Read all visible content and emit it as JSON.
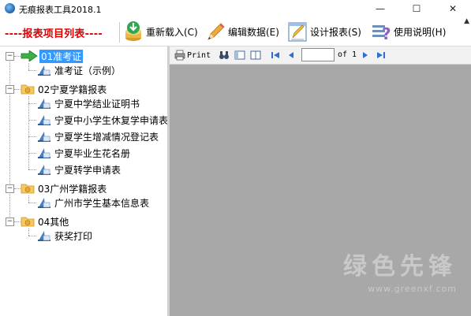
{
  "window": {
    "title": "无痕报表工具2018.1",
    "minimize": "—",
    "maximize": "☐",
    "close": "✕"
  },
  "toolbar": {
    "list_heading": "----报表项目列表----",
    "buttons": [
      {
        "label": "重新载入(C)",
        "icon": "reload-icon"
      },
      {
        "label": "编辑数据(E)",
        "icon": "pencil-icon"
      },
      {
        "label": "设计报表(S)",
        "icon": "design-icon"
      },
      {
        "label": "使用说明(H)",
        "icon": "help-icon"
      }
    ]
  },
  "tree": {
    "groups": [
      {
        "label": "01准考证",
        "selected": true,
        "items": [
          "准考证（示例）"
        ]
      },
      {
        "label": "02宁夏学籍报表",
        "items": [
          "宁夏中学结业证明书",
          "宁夏中小学生休复学申请表",
          "宁夏学生增减情况登记表",
          "宁夏毕业生花名册",
          "宁夏转学申请表"
        ]
      },
      {
        "label": "03广州学籍报表",
        "items": [
          "广州市学生基本信息表"
        ]
      },
      {
        "label": "04其他",
        "items": [
          "获奖打印"
        ]
      }
    ]
  },
  "viewer": {
    "print_label": "Print",
    "page_input": "",
    "page_of": "of 1"
  },
  "watermark": {
    "text": "绿色先锋",
    "url": "www.greenxf.com"
  },
  "colors": {
    "heading_red": "#e00000",
    "selection_blue": "#3399ff",
    "viewer_gray": "#a8a8a8"
  }
}
